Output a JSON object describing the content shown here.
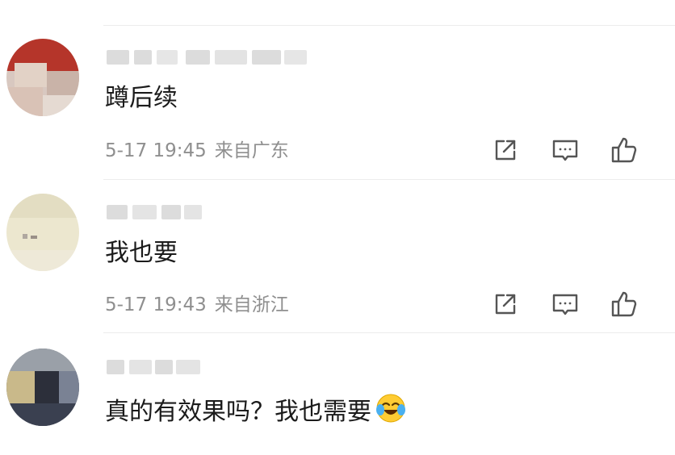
{
  "comments": [
    {
      "text": "蹲后续",
      "time": "5-17 19:45",
      "location": "来自广东",
      "avatar_color": "#c0392b"
    },
    {
      "text": "我也要",
      "time": "5-17 19:43",
      "location": "来自浙江",
      "avatar_color": "#ece7cf"
    },
    {
      "text": "真的有效果吗？我也需要",
      "emoji": "crying-laughing-emoji",
      "avatar_color": "#4a4f5e"
    }
  ],
  "icons": {
    "share": "share-icon",
    "comment": "comment-icon",
    "like": "thumbs-up-icon"
  },
  "colors": {
    "text": "#1b1b1b",
    "meta": "#8f8f8f",
    "icon": "#555555",
    "divider": "#ececec"
  }
}
